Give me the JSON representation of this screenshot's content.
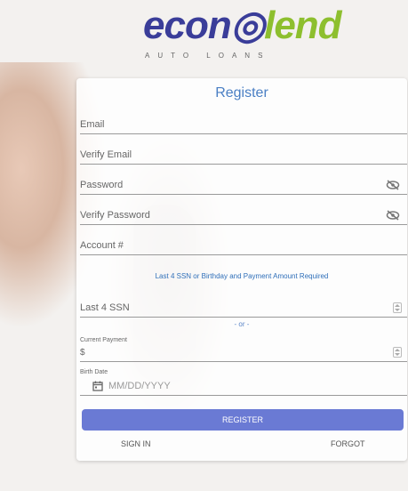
{
  "logo": {
    "brand_left": "econ",
    "brand_right": "lend",
    "tagline": "AUTO LOANS"
  },
  "card": {
    "title": "Register",
    "fields": {
      "email": "Email",
      "verify_email": "Verify Email",
      "password": "Password",
      "verify_password": "Verify Password",
      "account": "Account #",
      "last4_ssn": "Last 4 SSN"
    },
    "requirement_note": "Last 4 SSN or Birthday and Payment Amount Required",
    "or_text": "- or -",
    "current_payment": {
      "label": "Current Payment",
      "prefix": "$"
    },
    "birth_date": {
      "label": "Birth Date",
      "placeholder": "MM/DD/YYYY"
    },
    "buttons": {
      "register": "REGISTER",
      "sign_in": "SIGN IN",
      "forgot": "FORGOT"
    }
  }
}
